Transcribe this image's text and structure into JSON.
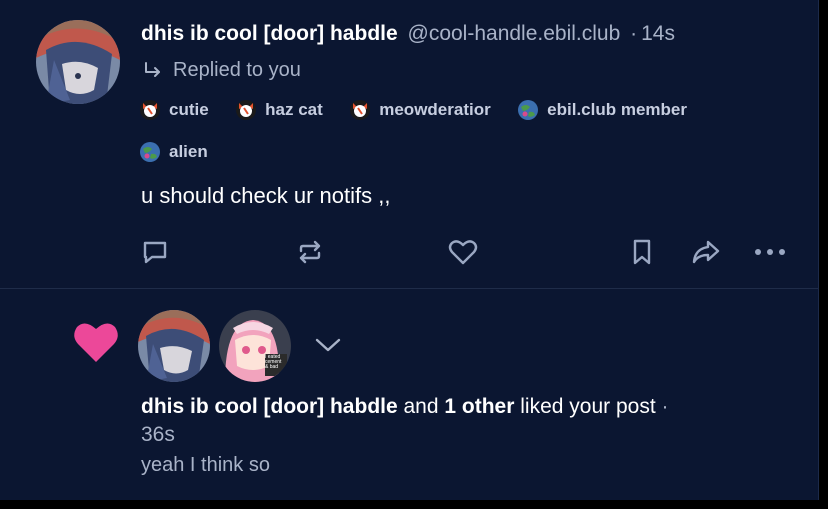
{
  "post": {
    "display_name": "dhis ib cool [door] habdle",
    "handle": "@cool-handle.ebil.club",
    "dot": "·",
    "time": "14s",
    "reply_label": "Replied to you",
    "badges": [
      {
        "label": "cutie"
      },
      {
        "label": "haz cat"
      },
      {
        "label": "meowderatior"
      },
      {
        "label": "ebil.club member"
      },
      {
        "label": "alien"
      }
    ],
    "text": "u should check ur notifs ,,"
  },
  "notification": {
    "actor": "dhis ib cool [door] habdle",
    "and": "and",
    "others": "1 other",
    "action": "liked your post",
    "dot": "·",
    "time": "36s",
    "quote": "yeah I think so",
    "sticker_text": "I eated cement & bad"
  },
  "colors": {
    "background": "#0b1631",
    "muted_text": "#a9b3c8",
    "like_pink": "#ec4899",
    "icon": "#9aa7c2"
  }
}
